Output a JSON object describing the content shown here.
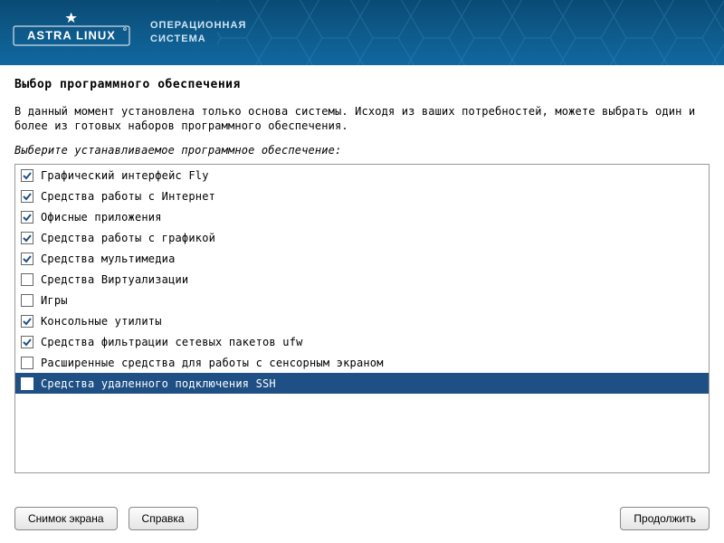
{
  "header": {
    "brand_top": "ASTRA LINUX",
    "brand_side_line1": "ОПЕРАЦИОННАЯ",
    "brand_side_line2": "СИСТЕМА"
  },
  "main": {
    "title": "Выбор программного обеспечения",
    "description": "В данный момент установлена только основа системы. Исходя из ваших потребностей, можете выбрать один и более из готовых наборов программного обеспечения.",
    "subprompt": "Выберите устанавливаемое программное обеспечение:"
  },
  "items": [
    {
      "label": "Графический интерфейс Fly",
      "checked": true,
      "selected": false
    },
    {
      "label": "Средства работы с Интернет",
      "checked": true,
      "selected": false
    },
    {
      "label": "Офисные приложения",
      "checked": true,
      "selected": false
    },
    {
      "label": "Средства работы с графикой",
      "checked": true,
      "selected": false
    },
    {
      "label": "Средства мультимедиа",
      "checked": true,
      "selected": false
    },
    {
      "label": "Средства Виртуализации",
      "checked": false,
      "selected": false
    },
    {
      "label": "Игры",
      "checked": false,
      "selected": false
    },
    {
      "label": "Консольные утилиты",
      "checked": true,
      "selected": false
    },
    {
      "label": "Средства фильтрации сетевых пакетов ufw",
      "checked": true,
      "selected": false
    },
    {
      "label": "Расширенные средства для работы с сенсорным экраном",
      "checked": false,
      "selected": false
    },
    {
      "label": "Средства удаленного подключения SSH",
      "checked": true,
      "selected": true
    }
  ],
  "footer": {
    "screenshot": "Снимок экрана",
    "help": "Справка",
    "continue": "Продолжить"
  },
  "colors": {
    "header_bg": "#0e5a8a",
    "selection_bg": "#1e4f85"
  }
}
